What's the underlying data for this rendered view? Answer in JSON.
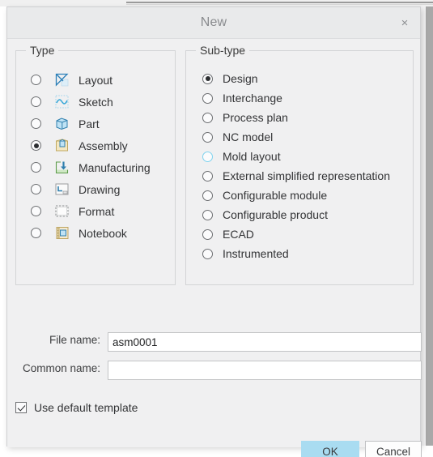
{
  "window": {
    "title": "New",
    "close_label": "×",
    "close_icon": "close-icon"
  },
  "type_group": {
    "legend": "Type",
    "items": [
      {
        "label": "Layout",
        "icon": "layout-icon",
        "selected": false,
        "hover": false
      },
      {
        "label": "Sketch",
        "icon": "sketch-icon",
        "selected": false,
        "hover": false
      },
      {
        "label": "Part",
        "icon": "part-icon",
        "selected": false,
        "hover": false
      },
      {
        "label": "Assembly",
        "icon": "assembly-icon",
        "selected": true,
        "hover": false
      },
      {
        "label": "Manufacturing",
        "icon": "manufacturing-icon",
        "selected": false,
        "hover": false
      },
      {
        "label": "Drawing",
        "icon": "drawing-icon",
        "selected": false,
        "hover": false
      },
      {
        "label": "Format",
        "icon": "format-icon",
        "selected": false,
        "hover": false
      },
      {
        "label": "Notebook",
        "icon": "notebook-icon",
        "selected": false,
        "hover": false
      }
    ]
  },
  "subtype_group": {
    "legend": "Sub-type",
    "items": [
      {
        "label": "Design",
        "selected": true,
        "hover": false
      },
      {
        "label": "Interchange",
        "selected": false,
        "hover": false
      },
      {
        "label": "Process plan",
        "selected": false,
        "hover": false
      },
      {
        "label": "NC model",
        "selected": false,
        "hover": false
      },
      {
        "label": "Mold layout",
        "selected": false,
        "hover": true
      },
      {
        "label": "External simplified representation",
        "selected": false,
        "hover": false
      },
      {
        "label": "Configurable module",
        "selected": false,
        "hover": false
      },
      {
        "label": "Configurable product",
        "selected": false,
        "hover": false
      },
      {
        "label": "ECAD",
        "selected": false,
        "hover": false
      },
      {
        "label": "Instrumented",
        "selected": false,
        "hover": false
      }
    ]
  },
  "fields": {
    "file_name_label": "File name:",
    "file_name_value": "asm0001",
    "file_name_placeholder": "",
    "common_name_label": "Common name:",
    "common_name_value": "",
    "common_name_placeholder": ""
  },
  "options": {
    "use_default_template_label": "Use default template",
    "use_default_template_checked": true
  },
  "footer": {
    "ok_label": "OK",
    "cancel_label": "Cancel"
  },
  "colors": {
    "dialog_background": "#f0f0f1",
    "titlebar_background": "#e9eaeb",
    "accent_ok": "#a9dcf1",
    "hover_ring": "#7fd3ef",
    "border": "#d3d4d6",
    "text": "#333436"
  }
}
